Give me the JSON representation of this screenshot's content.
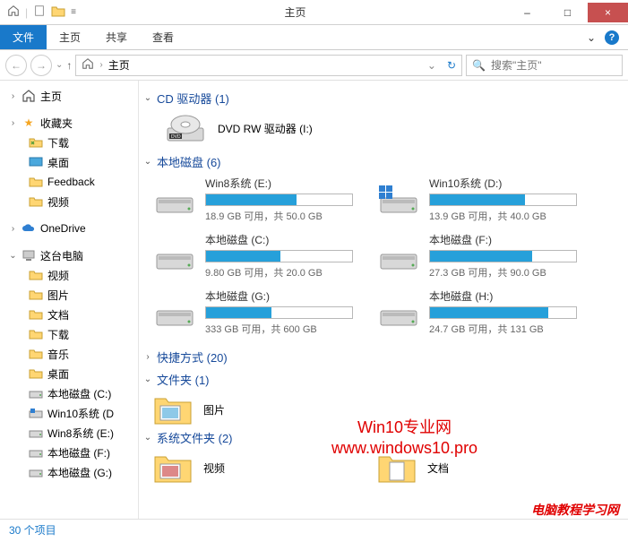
{
  "window": {
    "title": "主页",
    "minimize": "–",
    "maximize": "□",
    "close": "×"
  },
  "ribbon": {
    "tabs": [
      "文件",
      "主页",
      "共享",
      "查看"
    ],
    "expand": "⌄",
    "help": "?"
  },
  "addressbar": {
    "path": "主页",
    "search_placeholder": "搜索\"主页\""
  },
  "sidebar": {
    "home": "主页",
    "favorites": "收藏夹",
    "fav_items": [
      "下载",
      "桌面",
      "Feedback",
      "视频"
    ],
    "onedrive": "OneDrive",
    "this_pc": "这台电脑",
    "pc_items": [
      "视频",
      "图片",
      "文档",
      "下载",
      "音乐",
      "桌面",
      "本地磁盘 (C:)",
      "Win10系统 (D",
      "Win8系统 (E:)",
      "本地磁盘 (F:)",
      "本地磁盘 (G:)"
    ]
  },
  "main": {
    "cd_section": {
      "title": "CD 驱动器 (1)",
      "expanded": true
    },
    "dvd": {
      "label": "DVD RW 驱动器 (I:)"
    },
    "disk_section": {
      "title": "本地磁盘 (6)",
      "expanded": true
    },
    "drives": [
      {
        "name": "Win8系统 (E:)",
        "free": "18.9 GB 可用，共 50.0 GB",
        "fill": 62,
        "warn": false,
        "win": false
      },
      {
        "name": "Win10系统 (D:)",
        "free": "13.9 GB 可用，共 40.0 GB",
        "fill": 65,
        "warn": false,
        "win": true
      },
      {
        "name": "本地磁盘 (C:)",
        "free": "9.80 GB 可用，共 20.0 GB",
        "fill": 51,
        "warn": false,
        "win": false
      },
      {
        "name": "本地磁盘 (F:)",
        "free": "27.3 GB 可用，共 90.0 GB",
        "fill": 70,
        "warn": false,
        "win": false
      },
      {
        "name": "本地磁盘 (G:)",
        "free": "333 GB 可用，共 600 GB",
        "fill": 45,
        "warn": false,
        "win": false
      },
      {
        "name": "本地磁盘 (H:)",
        "free": "24.7 GB 可用，共 131 GB",
        "fill": 81,
        "warn": false,
        "win": false
      }
    ],
    "shortcuts": {
      "title": "快捷方式 (20)",
      "expanded": false
    },
    "folders": {
      "title": "文件夹 (1)",
      "expanded": true,
      "items": [
        "图片"
      ]
    },
    "sysfolders": {
      "title": "系统文件夹 (2)",
      "expanded": true,
      "items": [
        "视频",
        "文档"
      ]
    }
  },
  "status": {
    "count": "30 个项目"
  },
  "watermark": {
    "line1": "Win10专业网",
    "line2": "www.windows10.pro",
    "corner": "电脑教程学习网"
  }
}
